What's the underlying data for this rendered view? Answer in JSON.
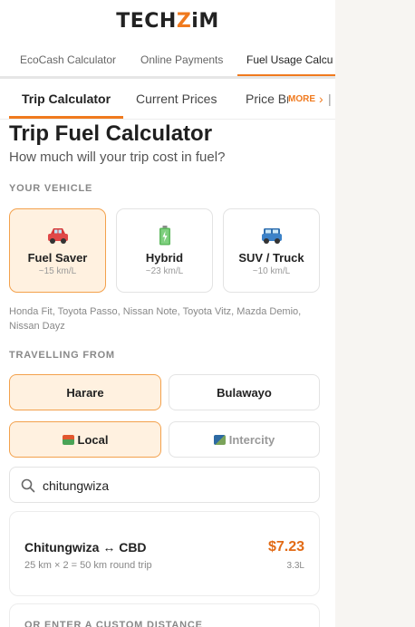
{
  "brand": {
    "logo_prefix": "TECH",
    "logo_accent": "Z",
    "logo_suffix": "iM",
    "accent_color": "#f07a1e"
  },
  "top_tabs": [
    {
      "label": "EcoCash Calculator",
      "active": false
    },
    {
      "label": "Online Payments",
      "active": false
    },
    {
      "label": "Fuel Usage Calcu",
      "active": true
    }
  ],
  "sub_tabs": [
    {
      "label": "Trip Calculator",
      "active": true
    },
    {
      "label": "Current Prices",
      "active": false
    },
    {
      "label": "Price Br",
      "active": false
    }
  ],
  "more_label": "MORE",
  "page": {
    "title": "Trip Fuel Calculator",
    "subtitle": "How much will your trip cost in fuel?"
  },
  "vehicle": {
    "section_label": "YOUR VEHICLE",
    "options": [
      {
        "name": "Fuel Saver",
        "efficiency": "~15 km/L",
        "icon": "red-car-icon",
        "selected": true
      },
      {
        "name": "Hybrid",
        "efficiency": "~23 km/L",
        "icon": "battery-icon",
        "selected": false
      },
      {
        "name": "SUV / Truck",
        "efficiency": "~10 km/L",
        "icon": "suv-icon",
        "selected": false
      }
    ],
    "examples": "Honda Fit, Toyota Passo, Nissan Note, Toyota Vitz, Mazda Demio, Nissan Dayz"
  },
  "origin": {
    "section_label": "TRAVELLING FROM",
    "cities": [
      {
        "label": "Harare",
        "selected": true
      },
      {
        "label": "Bulawayo",
        "selected": false
      }
    ],
    "modes": [
      {
        "label": "Local",
        "icon": "houses-icon",
        "selected": true
      },
      {
        "label": "Intercity",
        "icon": "road-icon",
        "selected": false
      }
    ]
  },
  "search": {
    "value": "chitungwiza",
    "placeholder": ""
  },
  "result": {
    "route": "Chitungwiza ↔ CBD",
    "detail": "25 km × 2 = 50 km round trip",
    "cost": "$7.23",
    "litres": "3.3L"
  },
  "custom_distance_label": "OR ENTER A CUSTOM DISTANCE"
}
